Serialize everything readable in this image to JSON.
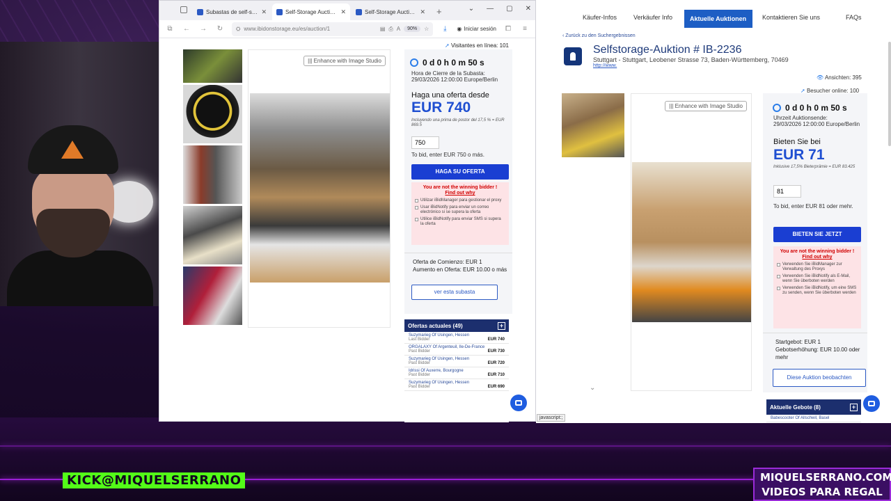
{
  "stream": {
    "kick_text": "KICK",
    "handle": "@MIQUELSERRANO",
    "promo_line1": "MIQUELSERRANO.COM",
    "promo_line2": "VIDEOS PARA REGAL"
  },
  "browser": {
    "tabs": [
      {
        "label": "Subastas de self-stora",
        "active": false
      },
      {
        "label": "Self-Storage Auction #",
        "active": true
      },
      {
        "label": "Self-Storage Auction #",
        "active": false
      }
    ],
    "url": "www.ibidonstorage.eu/es/auction/1",
    "zoom": "90%",
    "signin_label": "Iniciar sesión"
  },
  "left": {
    "visitors": "Visitantes en línea: 101",
    "enhance_label": "Enhance with Image Studio",
    "timer": "0 d 0 h 0 m 50 s",
    "close_label": "Hora de Cierre de la Subasta:",
    "close_time": "29/03/2026 12:00:00 Europe/Berlin",
    "offer_from": "Haga una oferta desde",
    "amount": "EUR 740",
    "premium": "Incluyendo una prima de postor del 17,5 % = EUR 869.5",
    "input_value": "750",
    "to_bid": "To bid, enter EUR 750 o más.",
    "bid_button": "HAGA SU OFERTA",
    "not_winning": "You are not the winning bidder !",
    "find_out": "Find out why",
    "options": [
      "Utilizar iBidManager para gestionar el proxy",
      "Usar iBidNotify para enviar un correo electrónico si se supera la oferta",
      "Utilice iBidNotify para enviar SMS si supera la oferta"
    ],
    "start_bid": "Oferta de Comienzo: EUR 1",
    "increment": "Aumento en Oferta: EUR 10.00 o más",
    "watch_button": "ver esta subasta",
    "offers_header": "Ofertas actuales (49)",
    "offers": [
      {
        "name": "Suzymarieg Of Usingen, Hessen",
        "status": "Last Bidder",
        "amount": "EUR 740"
      },
      {
        "name": "ORGALAXY Of Argenteuil, Ile-De-France",
        "status": "Past Bidder",
        "amount": "EUR 730"
      },
      {
        "name": "Suzymarieg Of Usingen, Hessen",
        "status": "Past Bidder",
        "amount": "EUR 720"
      },
      {
        "name": "Idrissi Of Auxerre, Bourgogne",
        "status": "Past Bidder",
        "amount": "EUR 710"
      },
      {
        "name": "Suzymarieg Of Usingen, Hessen",
        "status": "Past Bidder",
        "amount": "EUR 690"
      }
    ]
  },
  "right": {
    "nav": [
      "Käufer-Infos",
      "Verkäufer Info",
      "Aktuelle Auktionen",
      "Kontaktieren Sie uns",
      "FAQs"
    ],
    "back_link": "Zurück zu den Suchergebnissen",
    "title": "Selfstorage-Auktion # IB-2236",
    "address": "Stuttgart - Stuttgart, Leobener Strasse 73, Baden-Württemberg, 70469",
    "url": "http://www.",
    "views": "Ansichten: 395",
    "online": "Besucher online: 100",
    "enhance_label": "Enhance with Image Studio",
    "timer": "0 d 0 h 0 m 50 s",
    "close_label": "Uhrzeit Auktionsende:",
    "close_time": "29/03/2026 12:00:00 Europe/Berlin",
    "offer_from": "Bieten Sie bei",
    "amount": "EUR 71",
    "premium": "Inklusive 17,5% Bieterprämie = EUR 83.425",
    "input_value": "81",
    "to_bid": "To bid, enter EUR 81 oder mehr.",
    "bid_button": "BIETEN SIE JETZT",
    "not_winning": "You are not the winning bidder !",
    "find_out": "Find out why",
    "options": [
      "Verwenden Sie iBidManager zur Verwaltung des Proxys",
      "Verwenden Sie iBidNotify als E-Mail, wenn Sie überboten werden",
      "Verwenden Sie iBidNotify, um eine SMS zu senden, wenn Sie überboten werden"
    ],
    "start_bid": "Startgebot: EUR 1",
    "increment": "Gebotserhöhung: EUR 10.00 oder mehr",
    "watch_button": "Diese Auktion beobachten",
    "offers_header": "Aktuelle Gebote (8)",
    "offers_first": "Babescooter Of Allschwil, Basel",
    "status_text": "javascript:;"
  },
  "colors": {
    "accent_blue": "#1a3ed2",
    "kick_green": "#53fc18",
    "warn_red": "#d10000"
  }
}
